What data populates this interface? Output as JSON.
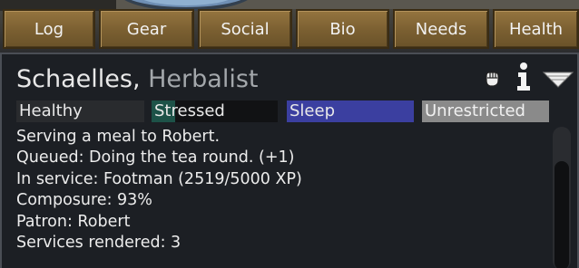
{
  "tabs": [
    {
      "label": "Log"
    },
    {
      "label": "Gear"
    },
    {
      "label": "Social"
    },
    {
      "label": "Bio"
    },
    {
      "label": "Needs"
    },
    {
      "label": "Health"
    }
  ],
  "pawn": {
    "name": "Schaelles",
    "separator": ",",
    "role": "Herbalist"
  },
  "header_icons": [
    "fist-icon",
    "info-icon",
    "collapse-icon"
  ],
  "statuses": {
    "health": "Healthy",
    "mood": "Stressed",
    "activity": "Sleep",
    "restriction": "Unrestricted"
  },
  "details": [
    "Serving a meal to Robert.",
    "Queued: Doing the tea round. (+1)",
    "In service: Footman (2519/5000 XP)",
    "Composure: 93%",
    "Patron: Robert",
    "Services rendered: 3"
  ],
  "colors": {
    "tab_brown": "#7a5f31",
    "sleep_bar": "#3b3fa0",
    "stressed_accent": "#1d5248",
    "unrestricted_bar": "#8a8a8a",
    "role_gray": "#a3a7ab"
  }
}
